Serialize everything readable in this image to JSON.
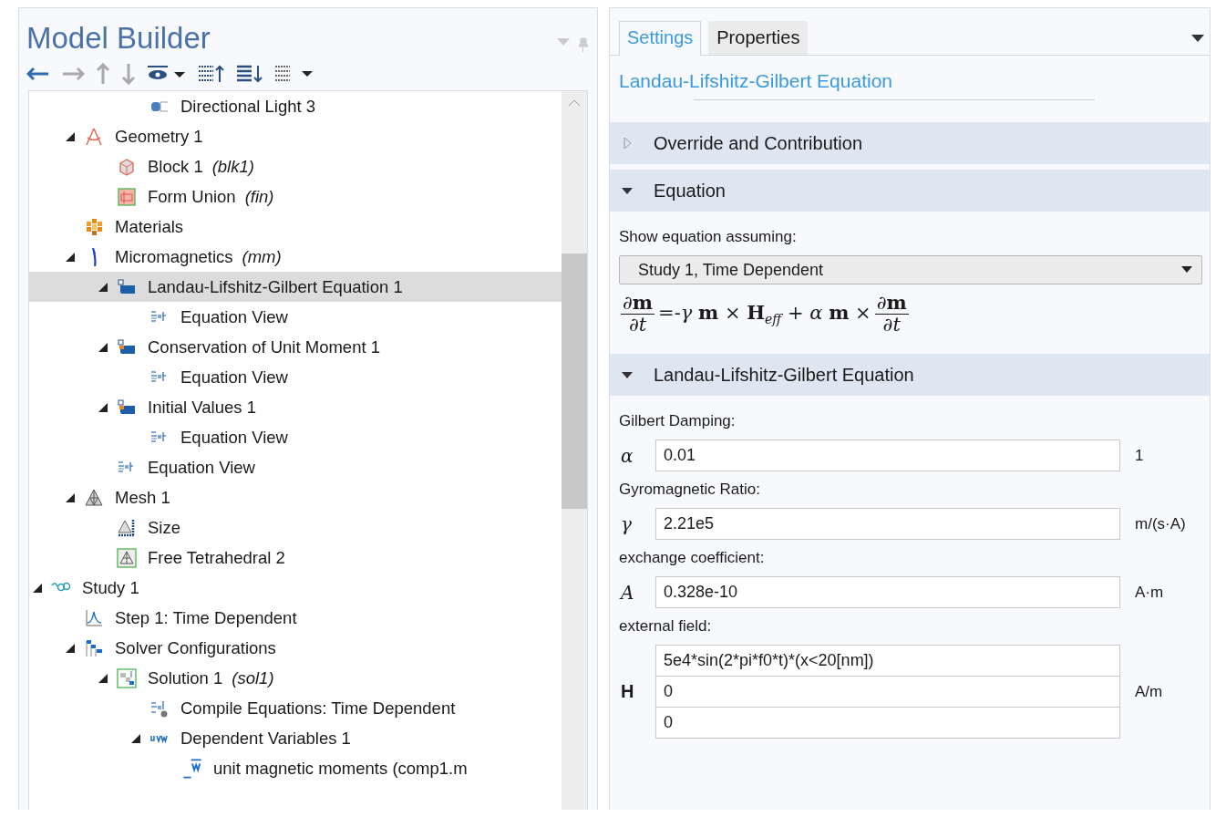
{
  "model_builder": {
    "title": "Model Builder",
    "tree": [
      {
        "children": [
          {
            "children": [
              {
                "children": [
                  {
                    "label": "Directional Light 3",
                    "kind": "light",
                    "selected": false
                  }
                ]
              }
            ]
          },
          {
            "label": "Geometry 1",
            "kind": "geometry",
            "expanded": true,
            "selected": false,
            "children": [
              {
                "label": "Block 1",
                "tag": "(blk1)",
                "kind": "block",
                "selected": false
              },
              {
                "label": "Form Union",
                "tag": "(fin)",
                "kind": "union",
                "selected": false
              }
            ]
          },
          {
            "label": "Materials",
            "kind": "materials",
            "selected": false
          },
          {
            "label": "Micromagnetics",
            "tag": "(mm)",
            "kind": "physics",
            "expanded": true,
            "selected": false,
            "children": [
              {
                "label": "Landau-Lifshitz-Gilbert Equation 1",
                "kind": "domain",
                "expanded": true,
                "selected": true,
                "children": [
                  {
                    "label": "Equation View",
                    "kind": "equation",
                    "selected": false
                  }
                ]
              },
              {
                "label": "Conservation of Unit Moment 1",
                "kind": "domain_default",
                "expanded": true,
                "selected": false,
                "children": [
                  {
                    "label": "Equation View",
                    "kind": "equation",
                    "selected": false
                  }
                ]
              },
              {
                "label": "Initial Values 1",
                "kind": "domain_default",
                "expanded": true,
                "selected": false,
                "children": [
                  {
                    "label": "Equation View",
                    "kind": "equation",
                    "selected": false
                  }
                ]
              },
              {
                "label": "Equation View",
                "kind": "equation",
                "selected": false
              }
            ]
          },
          {
            "label": "Mesh 1",
            "kind": "mesh",
            "expanded": true,
            "selected": false,
            "children": [
              {
                "label": "Size",
                "kind": "size",
                "selected": false
              },
              {
                "label": "Free Tetrahedral 2",
                "kind": "tetra",
                "selected": false
              }
            ]
          }
        ]
      },
      {
        "label": "Study 1",
        "kind": "study",
        "expanded": true,
        "selected": false,
        "children": [
          {
            "label": "Step 1: Time Dependent",
            "kind": "step",
            "selected": false
          },
          {
            "label": "Solver Configurations",
            "kind": "solver",
            "expanded": true,
            "selected": false,
            "children": [
              {
                "label": "Solution 1",
                "tag": "(sol1)",
                "kind": "solution",
                "expanded": true,
                "selected": false,
                "children": [
                  {
                    "label": "Compile Equations: Time Dependent",
                    "kind": "compile",
                    "selected": false
                  },
                  {
                    "label": "Dependent Variables 1",
                    "kind": "variables",
                    "expanded": true,
                    "selected": false,
                    "children": [
                      {
                        "label": "unit magnetic moments (comp1.m",
                        "kind": "field",
                        "selected": false
                      }
                    ]
                  }
                ]
              }
            ]
          }
        ]
      }
    ]
  },
  "settings": {
    "tabs": [
      {
        "label": "Settings",
        "selected": true
      },
      {
        "label": "Properties",
        "selected": false
      }
    ],
    "title": "Landau-Lifshitz-Gilbert Equation",
    "sections": [
      {
        "label": "Override and Contribution",
        "expanded": false
      },
      {
        "kind": "equation",
        "label": "Equation",
        "expanded": true,
        "prompt": "Show equation assuming:",
        "select": "Study 1, Time Dependent",
        "equation": {
          "lhs": {
            "num": "∂**m**",
            "den": "∂*t*"
          },
          "middle": "=-*γ* **m** × **H**$_{eff}$ + *α* **m** ×",
          "rhs": {
            "num": "∂**m**",
            "den": "∂*t*"
          }
        }
      },
      {
        "kind": "parameters",
        "label": "Landau-Lifshitz-Gilbert Equation",
        "expanded": true,
        "parameters": [
          {
            "kind": "scalar",
            "label": "Gilbert Damping:",
            "symbol": "α",
            "values": [
              "0.01"
            ],
            "unit": "1"
          },
          {
            "kind": "scalar",
            "label": "Gyromagnetic Ratio:",
            "symbol": "γ",
            "values": [
              "2.21e5"
            ],
            "unit": "m/(s·A)"
          },
          {
            "kind": "scalar",
            "label": "exchange coefficient:",
            "symbol": "A",
            "values": [
              "0.328e-10"
            ],
            "unit": "A·m"
          },
          {
            "kind": "vector",
            "label": "external field:",
            "symbol": "H",
            "values": [
              "5e4*sin(2*pi*f0*t)*(x<20[nm])",
              "0",
              "0"
            ],
            "unit": "A/m"
          }
        ]
      }
    ]
  }
}
